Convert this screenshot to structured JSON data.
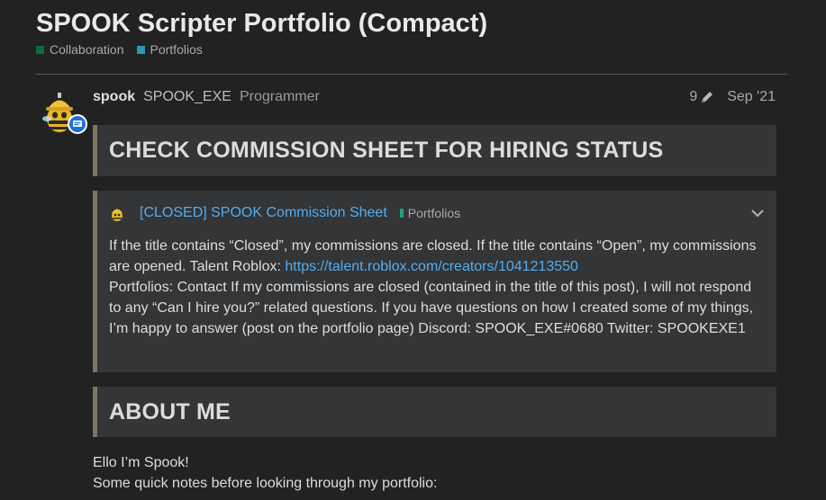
{
  "topic": {
    "title": "SPOOK Scripter Portfolio (Compact)",
    "tags": [
      {
        "label": "Collaboration",
        "color": "#0e6b3c"
      },
      {
        "label": "Portfolios",
        "color": "#2c94b5"
      }
    ]
  },
  "post": {
    "username": "spook",
    "full_name": "SPOOK_EXE",
    "user_title": "Programmer",
    "edit_count": "9",
    "date": "Sep '21",
    "heading1": "CHECK COMMISSION SHEET FOR HIRING STATUS",
    "onebox": {
      "title": "[CLOSED] SPOOK Commission Sheet",
      "category": "Portfolios",
      "category_color": "#1fa37a",
      "text_1": "If the title contains “Closed”, my commissions are closed. If the title contains “Open”, my commissions are opened. Talent Roblox: ",
      "link": "https://talent.roblox.com/creators/1041213550",
      "text_2": "Portfolios: Contact If my commissions are closed (contained in the title of this post), I will not respond to any “Can I hire you?” related questions. If you have questions on how I created some of my things, I’m happy to answer (post on the portfolio page) Discord: SPOOK_EXE#0680 Twitter: SPOOKEXE1"
    },
    "heading2": "ABOUT ME",
    "body_line_1": "Ello I’m Spook!",
    "body_line_2": "Some quick notes before looking through my portfolio:"
  },
  "colors": {
    "background": "#222222",
    "link": "#55acee",
    "block": "#333537",
    "quote_border": "#7e7462"
  },
  "icons": [
    "avatar-bee-helmet",
    "message-badge-icon",
    "pencil-icon",
    "chevron-down-icon"
  ]
}
